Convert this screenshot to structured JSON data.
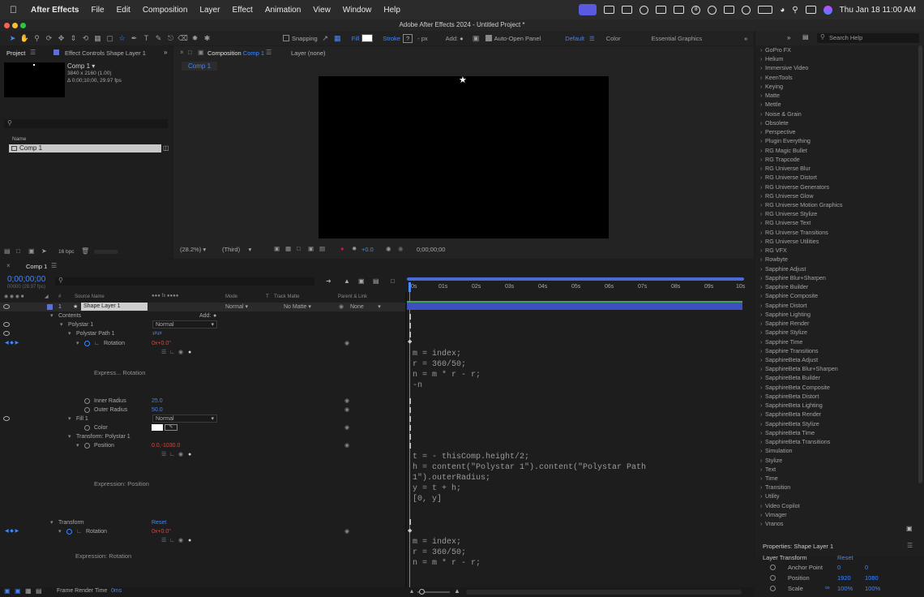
{
  "menubar": {
    "app": "After Effects",
    "menus": [
      "File",
      "Edit",
      "Composition",
      "Layer",
      "Effect",
      "Animation",
      "View",
      "Window",
      "Help"
    ],
    "clock": "Thu Jan 18  11:00 AM",
    "badge": "8"
  },
  "window_title": "Adobe After Effects 2024 - Untitled Project *",
  "toolbar": {
    "snapping": "Snapping",
    "fill": "Fill",
    "stroke": "Stroke",
    "stroke_val": "?",
    "px": "- px",
    "add": "Add:",
    "auto_open": "Auto-Open Panel",
    "workspace_default": "Default",
    "workspace_color": "Color",
    "workspace_eg": "Essential Graphics",
    "search_help": "Search Help"
  },
  "project_panel": {
    "tab_project": "Project",
    "tab_effect_controls": "Effect Controls Shape Layer 1",
    "comp_name": "Comp 1 ▾",
    "comp_info1": "3840 x 2160 (1.00)",
    "comp_info2": "Δ 0;00;10;00, 29.97 fps",
    "col_name": "Name",
    "item": "Comp 1",
    "bpc": "16 bpc"
  },
  "comp_viewer": {
    "tab": "Composition",
    "tab_comp": "Comp 1",
    "layer_tab": "Layer (none)",
    "breadcrumb": "Comp 1",
    "zoom": "(28.2%)",
    "res": "(Third)",
    "exposure": "+0.0",
    "timecode": "0;00;00;00"
  },
  "timeline": {
    "tab": "Comp 1",
    "timecode": "0;00;00;00",
    "fps": "00000 (29.97 fps)",
    "cols": {
      "source": "Source Name",
      "mode": "Mode",
      "t": "T",
      "track_matte": "Track Matte",
      "parent": "Parent & Link"
    },
    "ruler": [
      "0s",
      "01s",
      "02s",
      "03s",
      "04s",
      "05s",
      "06s",
      "07s",
      "08s",
      "09s",
      "10s"
    ],
    "layer": {
      "num": "1",
      "name": "Shape Layer 1",
      "mode": "Normal",
      "matte": "No Matte",
      "parent": "None"
    },
    "rows": {
      "contents": "Contents",
      "add": "Add:",
      "polystar": "Polystar 1",
      "polystar_mode": "Normal",
      "polystar_path": "Polystar Path 1",
      "rotation": "Rotation",
      "rotation_val": "0x+0.0°",
      "expr_rotation_short": "Express... Rotation",
      "inner_radius": "Inner Radius",
      "inner_radius_val": "25.0",
      "outer_radius": "Outer Radius",
      "outer_radius_val": "50.0",
      "fill": "Fill 1",
      "fill_mode": "Normal",
      "color": "Color",
      "transform_polystar": "Transform: Polystar 1",
      "position": "Position",
      "position_val": "0.0,-1030.0",
      "expr_position": "Expression: Position",
      "transform": "Transform",
      "reset": "Reset",
      "rotation2": "Rotation",
      "rotation2_val": "0x+0.0°",
      "expr_rotation": "Expression: Rotation"
    },
    "code1": "m = index;\nr = 360/50;\nn = m * r - r;\n-n",
    "code2": "t = - thisComp.height/2;\nh = content(\"Polystar 1\").content(\"Polystar Path\n1\").outerRadius;\ny = t + h;\n[0, y]",
    "code3": "m = index;\nr = 360/50;\nn = m * r - r;",
    "frame_render": "Frame Render Time",
    "frame_render_val": "0ms"
  },
  "effects_list": [
    "GoPro FX",
    "Helium",
    "Immersive Video",
    "KeenTools",
    "Keying",
    "Matte",
    "Mettle",
    "Noise & Grain",
    "Obsolete",
    "Perspective",
    "Plugin Everything",
    "RG Magic Bullet",
    "RG Trapcode",
    "RG Universe Blur",
    "RG Universe Distort",
    "RG Universe Generators",
    "RG Universe Glow",
    "RG Universe Motion Graphics",
    "RG Universe Stylize",
    "RG Universe Text",
    "RG Universe Transitions",
    "RG Universe Utilities",
    "RG VFX",
    "Rowbyte",
    "Sapphire Adjust",
    "Sapphire Blur+Sharpen",
    "Sapphire Builder",
    "Sapphire Composite",
    "Sapphire Distort",
    "Sapphire Lighting",
    "Sapphire Render",
    "Sapphire Stylize",
    "Sapphire Time",
    "Sapphire Transitions",
    "SapphireBeta Adjust",
    "SapphireBeta Blur+Sharpen",
    "SapphireBeta Builder",
    "SapphireBeta Composite",
    "SapphireBeta Distort",
    "SapphireBeta Lighting",
    "SapphireBeta Render",
    "SapphireBeta Stylize",
    "SapphireBeta Time",
    "SapphireBeta Transitions",
    "Simulation",
    "Stylize",
    "Text",
    "Time",
    "Transition",
    "Utility",
    "Video Copilot",
    "Vimager",
    "Vranos"
  ],
  "properties": {
    "title": "Properties: Shape Layer 1",
    "section": "Layer Transform",
    "reset": "Reset",
    "anchor": "Anchor Point",
    "anchor_x": "0",
    "anchor_y": "0",
    "position": "Position",
    "position_x": "1920",
    "position_y": "1080",
    "scale": "Scale",
    "scale_x": "100%",
    "scale_y": "100%"
  },
  "colors": {
    "accent": "#3f86ff",
    "layer_bar": "#3e4fc2",
    "keyframe_red": "#e0453a"
  }
}
